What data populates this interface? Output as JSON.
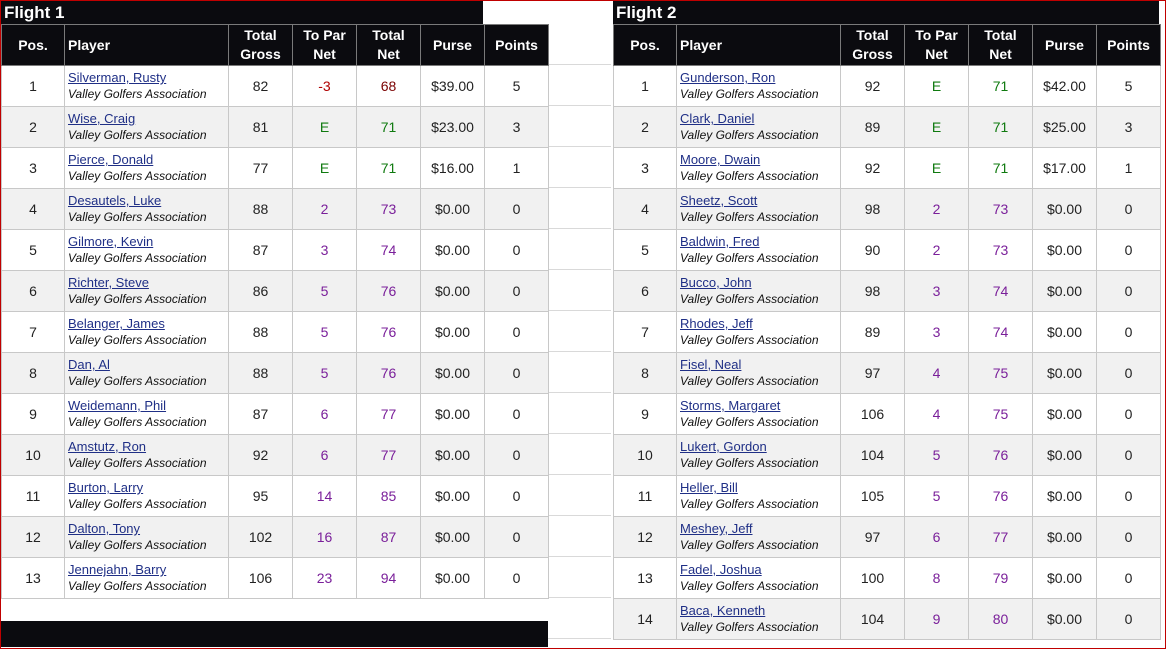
{
  "flight1": {
    "title": "Flight 1",
    "headers": {
      "pos": "Pos.",
      "player": "Player",
      "gross_a": "Total",
      "gross_b": "Gross",
      "topar_a": "To Par",
      "topar_b": "Net",
      "net_a": "Total",
      "net_b": "Net",
      "purse": "Purse",
      "points": "Points"
    },
    "rows": [
      {
        "pos": "1",
        "name": "Silverman, Rusty",
        "club": "Valley Golfers Association",
        "gross": "82",
        "topar": "-3",
        "net": "68",
        "purse": "$39.00",
        "points": "5"
      },
      {
        "pos": "2",
        "name": "Wise, Craig",
        "club": "Valley Golfers Association",
        "gross": "81",
        "topar": "E",
        "net": "71",
        "purse": "$23.00",
        "points": "3"
      },
      {
        "pos": "3",
        "name": "Pierce, Donald",
        "club": "Valley Golfers Association",
        "gross": "77",
        "topar": "E",
        "net": "71",
        "purse": "$16.00",
        "points": "1"
      },
      {
        "pos": "4",
        "name": "Desautels, Luke",
        "club": "Valley Golfers Association",
        "gross": "88",
        "topar": "2",
        "net": "73",
        "purse": "$0.00",
        "points": "0"
      },
      {
        "pos": "5",
        "name": "Gilmore, Kevin",
        "club": "Valley Golfers Association",
        "gross": "87",
        "topar": "3",
        "net": "74",
        "purse": "$0.00",
        "points": "0"
      },
      {
        "pos": "6",
        "name": "Richter, Steve",
        "club": "Valley Golfers Association",
        "gross": "86",
        "topar": "5",
        "net": "76",
        "purse": "$0.00",
        "points": "0"
      },
      {
        "pos": "7",
        "name": "Belanger, James",
        "club": "Valley Golfers Association",
        "gross": "88",
        "topar": "5",
        "net": "76",
        "purse": "$0.00",
        "points": "0"
      },
      {
        "pos": "8",
        "name": "Dan, Al",
        "club": "Valley Golfers Association",
        "gross": "88",
        "topar": "5",
        "net": "76",
        "purse": "$0.00",
        "points": "0"
      },
      {
        "pos": "9",
        "name": "Weidemann, Phil",
        "club": "Valley Golfers Association",
        "gross": "87",
        "topar": "6",
        "net": "77",
        "purse": "$0.00",
        "points": "0"
      },
      {
        "pos": "10",
        "name": "Amstutz, Ron",
        "club": "Valley Golfers Association",
        "gross": "92",
        "topar": "6",
        "net": "77",
        "purse": "$0.00",
        "points": "0"
      },
      {
        "pos": "11",
        "name": "Burton, Larry",
        "club": "Valley Golfers Association",
        "gross": "95",
        "topar": "14",
        "net": "85",
        "purse": "$0.00",
        "points": "0"
      },
      {
        "pos": "12",
        "name": "Dalton, Tony",
        "club": "Valley Golfers Association",
        "gross": "102",
        "topar": "16",
        "net": "87",
        "purse": "$0.00",
        "points": "0"
      },
      {
        "pos": "13",
        "name": "Jennejahn, Barry",
        "club": "Valley Golfers Association",
        "gross": "106",
        "topar": "23",
        "net": "94",
        "purse": "$0.00",
        "points": "0"
      }
    ]
  },
  "flight2": {
    "title": "Flight 2",
    "headers": {
      "pos": "Pos.",
      "player": "Player",
      "gross_a": "Total",
      "gross_b": "Gross",
      "topar_a": "To Par",
      "topar_b": "Net",
      "net_a": "Total",
      "net_b": "Net",
      "purse": "Purse",
      "points": "Points"
    },
    "rows": [
      {
        "pos": "1",
        "name": "Gunderson, Ron",
        "club": "Valley Golfers Association",
        "gross": "92",
        "topar": "E",
        "net": "71",
        "purse": "$42.00",
        "points": "5"
      },
      {
        "pos": "2",
        "name": "Clark, Daniel",
        "club": "Valley Golfers Association",
        "gross": "89",
        "topar": "E",
        "net": "71",
        "purse": "$25.00",
        "points": "3"
      },
      {
        "pos": "3",
        "name": "Moore, Dwain",
        "club": "Valley Golfers Association",
        "gross": "92",
        "topar": "E",
        "net": "71",
        "purse": "$17.00",
        "points": "1"
      },
      {
        "pos": "4",
        "name": "Sheetz, Scott",
        "club": "Valley Golfers Association",
        "gross": "98",
        "topar": "2",
        "net": "73",
        "purse": "$0.00",
        "points": "0"
      },
      {
        "pos": "5",
        "name": "Baldwin, Fred",
        "club": "Valley Golfers Association",
        "gross": "90",
        "topar": "2",
        "net": "73",
        "purse": "$0.00",
        "points": "0"
      },
      {
        "pos": "6",
        "name": "Bucco, John",
        "club": "Valley Golfers Association",
        "gross": "98",
        "topar": "3",
        "net": "74",
        "purse": "$0.00",
        "points": "0"
      },
      {
        "pos": "7",
        "name": "Rhodes, Jeff",
        "club": "Valley Golfers Association",
        "gross": "89",
        "topar": "3",
        "net": "74",
        "purse": "$0.00",
        "points": "0"
      },
      {
        "pos": "8",
        "name": "Fisel, Neal",
        "club": "Valley Golfers Association",
        "gross": "97",
        "topar": "4",
        "net": "75",
        "purse": "$0.00",
        "points": "0"
      },
      {
        "pos": "9",
        "name": "Storms, Margaret",
        "club": "Valley Golfers Association",
        "gross": "106",
        "topar": "4",
        "net": "75",
        "purse": "$0.00",
        "points": "0"
      },
      {
        "pos": "10",
        "name": "Lukert, Gordon",
        "club": "Valley Golfers Association",
        "gross": "104",
        "topar": "5",
        "net": "76",
        "purse": "$0.00",
        "points": "0"
      },
      {
        "pos": "11",
        "name": "Heller, Bill",
        "club": "Valley Golfers Association",
        "gross": "105",
        "topar": "5",
        "net": "76",
        "purse": "$0.00",
        "points": "0"
      },
      {
        "pos": "12",
        "name": "Meshey, Jeff",
        "club": "Valley Golfers Association",
        "gross": "97",
        "topar": "6",
        "net": "77",
        "purse": "$0.00",
        "points": "0"
      },
      {
        "pos": "13",
        "name": "Fadel, Joshua",
        "club": "Valley Golfers Association",
        "gross": "100",
        "topar": "8",
        "net": "79",
        "purse": "$0.00",
        "points": "0"
      },
      {
        "pos": "14",
        "name": "Baca, Kenneth",
        "club": "Valley Golfers Association",
        "gross": "104",
        "topar": "9",
        "net": "80",
        "purse": "$0.00",
        "points": "0"
      }
    ]
  },
  "colors": {
    "header_bg": "#0b0b0f",
    "link": "#1f2f86",
    "under_par": "#b00000",
    "even_par": "#0f7a0f",
    "over_par": "#7a1f9a",
    "frame": "#c00000"
  }
}
